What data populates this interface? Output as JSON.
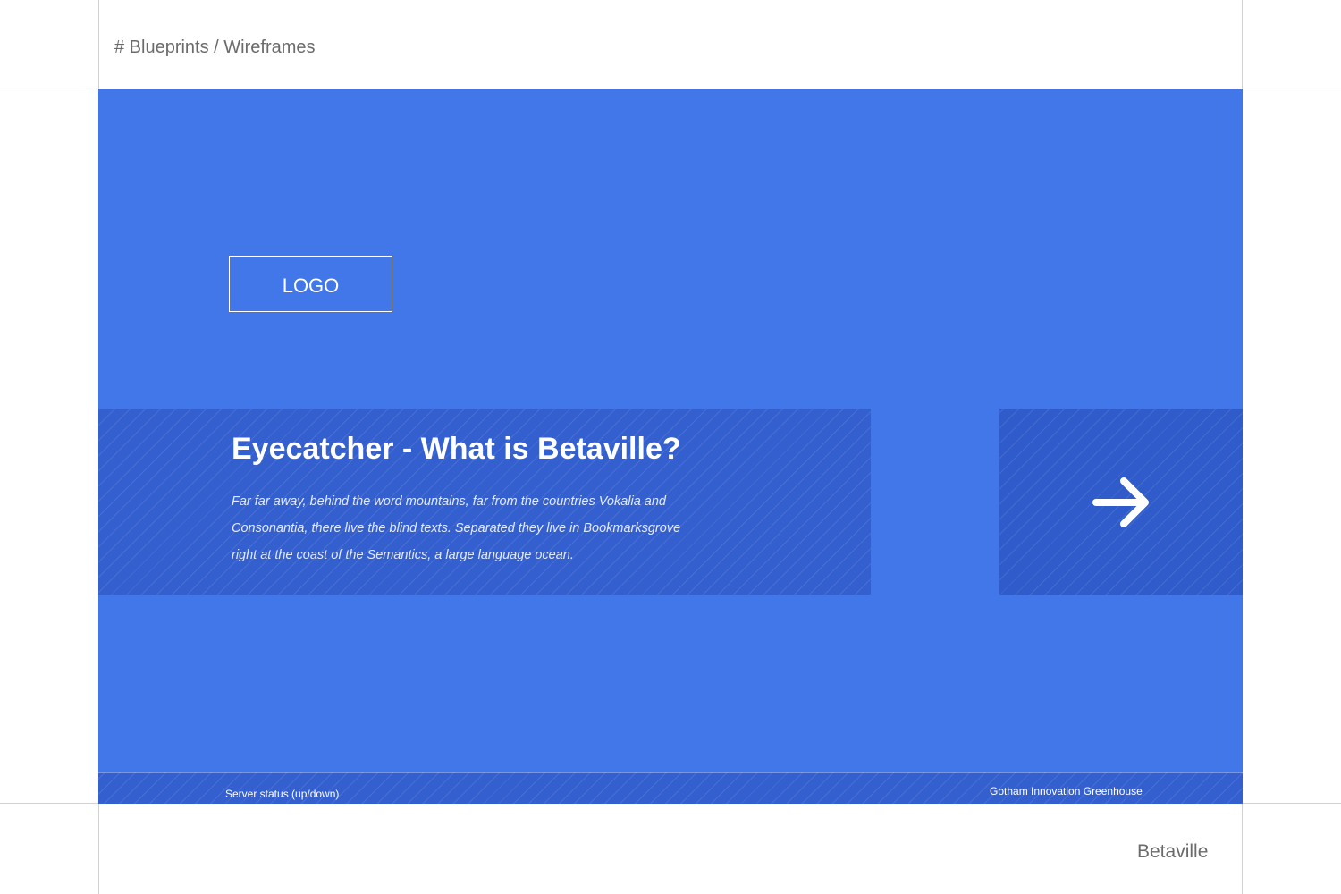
{
  "header": {
    "breadcrumb": "# Blueprints / Wireframes"
  },
  "colors": {
    "accent_blue": "#4277e9",
    "panel_blue": "#345fcf",
    "guide_gray": "#d2d2d2",
    "text_gray": "#6b6b6b"
  },
  "hero": {
    "logo_label": "LOGO",
    "title": "Eyecatcher - What is Betaville?",
    "description": "Far far away, behind the word mountains, far from the countries Vokalia and Consonantia, there live the blind texts. Separated they live in Bookmarksgrove right at the coast of the Semantics, a large language ocean.",
    "next_icon": "arrow-right-icon"
  },
  "footer": {
    "server_status": "Server status (up/down)",
    "organization": "Gotham Innovation Greenhouse"
  },
  "brand": {
    "name": "Betaville"
  }
}
